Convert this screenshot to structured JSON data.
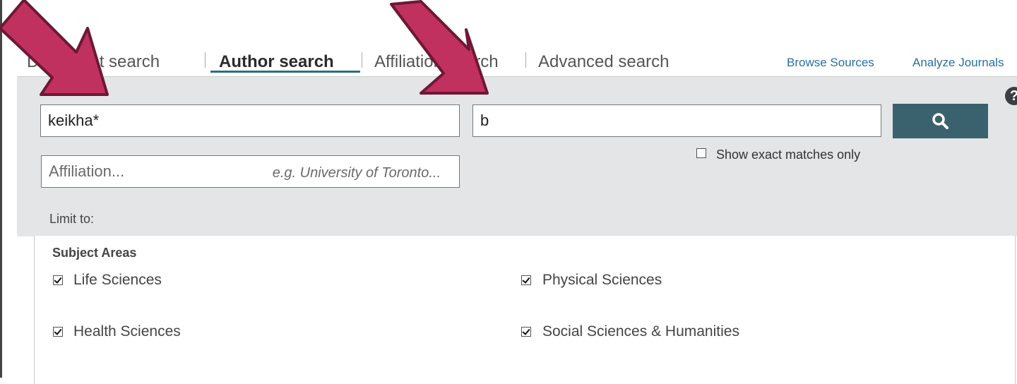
{
  "tabs": {
    "document": "Document search",
    "author": "Author search",
    "affiliation": "Affiliation search",
    "advanced": "Advanced search"
  },
  "links": {
    "browse_sources": "Browse Sources",
    "analyze_journals": "Analyze Journals"
  },
  "help": {
    "label": "?"
  },
  "search": {
    "last_name_value": "keikha*",
    "first_name_value": "b",
    "affiliation_placeholder": "Affiliation...",
    "affiliation_hint": "e.g. University of Toronto...",
    "exact_matches_label": "Show exact matches only",
    "exact_matches_checked": false
  },
  "limit": {
    "label": "Limit to:",
    "subject_title": "Subject Areas",
    "subjects": [
      {
        "label": "Life Sciences",
        "checked": true
      },
      {
        "label": "Physical Sciences",
        "checked": true
      },
      {
        "label": "Health Sciences",
        "checked": true
      },
      {
        "label": "Social Sciences & Humanities",
        "checked": true
      }
    ]
  },
  "colors": {
    "arrow": "#c0315f",
    "arrow_outline": "#6e1836",
    "search_button": "#39626e",
    "tab_underline": "#2e6e7e",
    "link": "#2a6fa6"
  },
  "icons": [
    "search-icon",
    "help-icon",
    "arrow-annotation"
  ]
}
